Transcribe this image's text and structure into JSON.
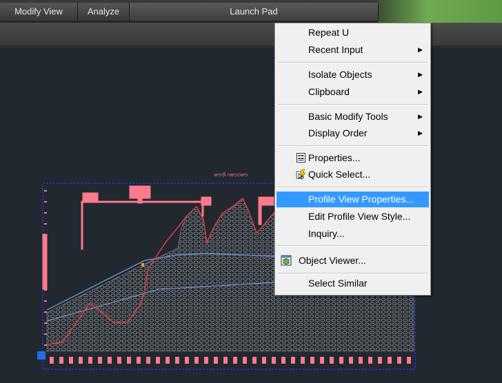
{
  "ribbon": {
    "tabs": [
      "Modify View",
      "Analyze",
      "Launch Pad"
    ]
  },
  "drawing": {
    "title_text": "ഔൗീ ഠഔഠഔ"
  },
  "context_menu": {
    "items": [
      {
        "label": "Repeat U",
        "submenu": false
      },
      {
        "label": "Recent Input",
        "submenu": true
      },
      {
        "label": "Isolate Objects",
        "submenu": true
      },
      {
        "label": "Clipboard",
        "submenu": true
      },
      {
        "label": "Basic Modify Tools",
        "submenu": true
      },
      {
        "label": "Display Order",
        "submenu": true
      },
      {
        "label": "Properties...",
        "submenu": false,
        "icon": "properties-icon"
      },
      {
        "label": "Quick Select...",
        "submenu": false,
        "icon": "quick-select-icon"
      },
      {
        "label": "Profile View Properties...",
        "submenu": false,
        "highlighted": true
      },
      {
        "label": "Edit Profile View Style...",
        "submenu": false
      },
      {
        "label": "Inquiry...",
        "submenu": false
      },
      {
        "label": "Object Viewer...",
        "submenu": false,
        "icon": "object-viewer-icon"
      },
      {
        "label": "Select Similar",
        "submenu": false
      }
    ]
  },
  "colors": {
    "highlight": "#3399ff",
    "profile_line": "#e63a3a",
    "grid_border": "#3030c8",
    "annotation": "#ff7a8a"
  }
}
